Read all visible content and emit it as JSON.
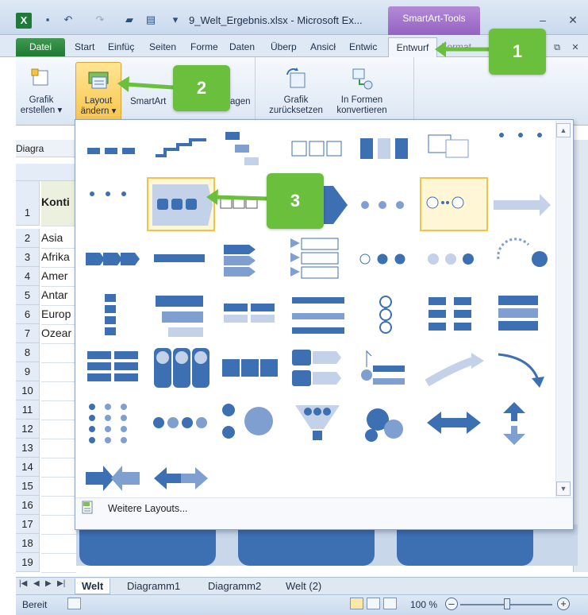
{
  "window": {
    "title": "9_Welt_Ergebnis.xlsx - Microsoft Ex...",
    "context_tab_group": "SmartArt-Tools"
  },
  "ribbon_tabs": [
    "Datei",
    "Start",
    "Einfüç",
    "Seiten",
    "Forme",
    "Daten",
    "Überp",
    "Ansicł",
    "Entwic",
    "Entwurf",
    "Format"
  ],
  "ribbon": {
    "add_shape": "Grafik\nerstellen ▾",
    "change_layout": "Layout\nändern ▾",
    "smartart_label": "SmartArt",
    "hidden_label": "agen",
    "reset_graphic": "Grafik\nzurücksetzen",
    "convert_to_shapes": "In Formen\nkonvertieren"
  },
  "sheet": {
    "namebox": "Diagra",
    "rows": [
      {
        "num": "1",
        "text": "Konti"
      },
      {
        "num": "2",
        "text": "Asia"
      },
      {
        "num": "3",
        "text": "Afrika"
      },
      {
        "num": "4",
        "text": "Amer"
      },
      {
        "num": "5",
        "text": "Antar"
      },
      {
        "num": "6",
        "text": "Europ"
      },
      {
        "num": "7",
        "text": "Ozear"
      },
      {
        "num": "8",
        "text": ""
      },
      {
        "num": "9",
        "text": ""
      },
      {
        "num": "10",
        "text": ""
      },
      {
        "num": "11",
        "text": ""
      },
      {
        "num": "12",
        "text": ""
      },
      {
        "num": "13",
        "text": ""
      },
      {
        "num": "14",
        "text": ""
      },
      {
        "num": "15",
        "text": ""
      },
      {
        "num": "16",
        "text": ""
      },
      {
        "num": "17",
        "text": ""
      },
      {
        "num": "18",
        "text": ""
      },
      {
        "num": "19",
        "text": ""
      }
    ]
  },
  "gallery": {
    "more_layouts": "Weitere Layouts..."
  },
  "sheet_tabs": [
    "Welt",
    "Diagramm1",
    "Diagramm2",
    "Welt (2)"
  ],
  "status": {
    "ready": "Bereit",
    "zoom": "100 %",
    "zoom_level_percent": 100
  },
  "callouts": [
    "1",
    "2",
    "3"
  ],
  "colors": {
    "accent_green": "#6abf3c",
    "smartart_blue": "#3d6fb3",
    "selection_yellow": "#f2c24b"
  }
}
